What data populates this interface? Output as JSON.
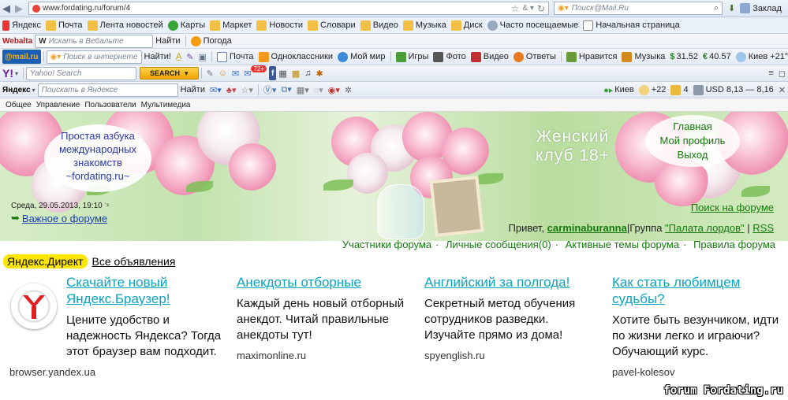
{
  "browser": {
    "url": "www.fordating.ru/forum/4",
    "search_placeholder": "Поиск@Mail.Ru",
    "bookmarks_menu": "Заклад"
  },
  "bookmarks": [
    "Яндекс",
    "Почта",
    "Лента новостей",
    "Карты",
    "Маркет",
    "Новости",
    "Словари",
    "Видео",
    "Музыка",
    "Диск",
    "Часто посещаемые",
    "Начальная страница"
  ],
  "webalta": {
    "logo": "Webalta",
    "search_placeholder": "Искать в Вебальте",
    "find": "Найти",
    "weather": "Погода"
  },
  "mailru_bar": {
    "logo": "@mail.ru",
    "search_placeholder": "Поиск в интернете",
    "find": "Найти!",
    "items": [
      "Почта",
      "Одноклассники",
      "Мой мир",
      "Игры",
      "Фото",
      "Видео",
      "Ответы",
      "Нравится",
      "Музыка"
    ],
    "usd": "31.52",
    "eur": "40.57",
    "weather": "Киев +21°C"
  },
  "yahoo_bar": {
    "logo": "Y!",
    "search_placeholder": "Yahoo! Search",
    "search_button": "SEARCH",
    "mail_badge": "72+"
  },
  "yandex_bar": {
    "logo": "Яндекс",
    "search_placeholder": "Поискать в Яндексе",
    "find": "Найти",
    "city": "Киев",
    "temp": "+22",
    "count": "4",
    "rate": "USD 8,13 — 8,16"
  },
  "menu": [
    "Общее",
    "Управление",
    "Пользователи",
    "Мультимедиа"
  ],
  "page": {
    "bubble_left": [
      "Простая азбука",
      "международных",
      "знакомств",
      "~fordating.ru~"
    ],
    "club_title": [
      "Женский",
      "клуб 18+"
    ],
    "nav_right": [
      "Главная",
      "Мой профиль",
      "Выход"
    ],
    "date": "Среда, 29.05.2013, 19:10",
    "important": "Важное о форуме",
    "search_forum": "Поиск на форуме",
    "greeting": {
      "hello": "Привет, ",
      "user": "carminaburanna",
      "group_prefix": "Группа ",
      "group": "\"Палата лордов\"",
      "rss": "RSS"
    },
    "forum_nav": [
      "Участники форума",
      "Личные сообщения(0)",
      "Активные темы форума",
      "Правила форума"
    ],
    "watermark": "forum Fordating.ru"
  },
  "direct": {
    "label": "Яндекс.Директ",
    "all": "Все объявления",
    "ads": [
      {
        "title": "Скачайте новый Яндекс.Браузер!",
        "text": "Цените удобство и надежность Яндекса? Тогда этот браузер вам подходит.",
        "domain": "browser.yandex.ua"
      },
      {
        "title": "Анекдоты отборные",
        "text": "Каждый день новый отборный анекдот. Читай правильные анекдоты тут!",
        "domain": "maximonline.ru"
      },
      {
        "title": "Английский за полгода!",
        "text": "Секретный метод обучения сотрудников разведки. Изучайте прямо из дома!",
        "domain": "spyenglish.ru"
      },
      {
        "title": "Как стать любимцем судьбы?",
        "text": "Хотите быть везунчиком, идти по жизни легко и играючи? Обучающий курс.",
        "domain": "pavel-kolesov"
      }
    ]
  },
  "colors": {
    "link_green": "#147a0c",
    "link_blue": "#1b3fb0",
    "ad_title": "#0aa5c0",
    "direct_highlight": "#ffe600"
  }
}
